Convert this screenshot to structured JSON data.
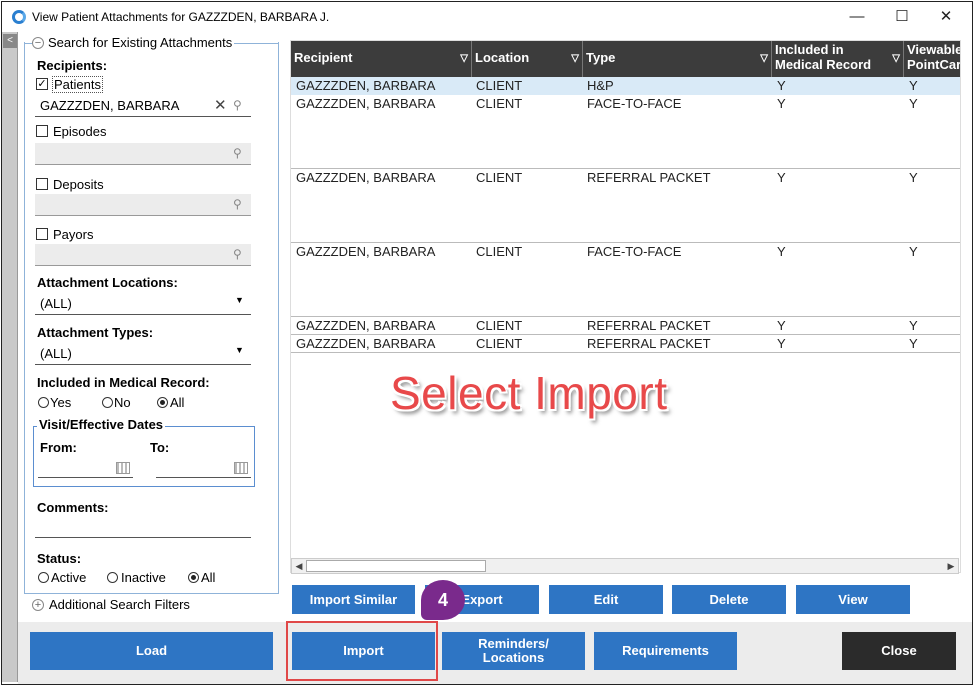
{
  "window": {
    "title": "View Patient Attachments for GAZZZDEN, BARBARA J.",
    "minimize": "—",
    "maximize": "☐",
    "close": "✕"
  },
  "search": {
    "legend": "Search for Existing Attachments",
    "recipients_label": "Recipients:",
    "patients_label": "Patients",
    "patients_checked": true,
    "patient_value": "GAZZZDEN, BARBARA",
    "episodes_label": "Episodes",
    "deposits_label": "Deposits",
    "payors_label": "Payors",
    "locations_label": "Attachment Locations:",
    "locations_value": "(ALL)",
    "types_label": "Attachment Types:",
    "types_value": "(ALL)",
    "medrec_label": "Included in Medical Record:",
    "medrec_options": [
      "Yes",
      "No",
      "All"
    ],
    "medrec_selected": "All",
    "dates_label": "Visit/Effective Dates",
    "from_label": "From:",
    "to_label": "To:",
    "comments_label": "Comments:",
    "status_label": "Status:",
    "status_options": [
      "Active",
      "Inactive",
      "All"
    ],
    "status_selected": "All",
    "additional_label": "Additional Search Filters"
  },
  "grid": {
    "columns": [
      "Recipient",
      "Location",
      "Type",
      "Included in Medical Record",
      "Viewable PointCar"
    ],
    "rows": [
      [
        "GAZZZDEN, BARBARA",
        "CLIENT",
        "H&P",
        "Y",
        "Y"
      ],
      [
        "GAZZZDEN, BARBARA",
        "CLIENT",
        "FACE-TO-FACE",
        "Y",
        "Y"
      ],
      [
        "GAZZZDEN, BARBARA",
        "CLIENT",
        "REFERRAL PACKET",
        "Y",
        "Y"
      ],
      [
        "GAZZZDEN, BARBARA",
        "CLIENT",
        "FACE-TO-FACE",
        "Y",
        "Y"
      ],
      [
        "GAZZZDEN, BARBARA",
        "CLIENT",
        "REFERRAL PACKET",
        "Y",
        "Y"
      ],
      [
        "GAZZZDEN, BARBARA",
        "CLIENT",
        "REFERRAL PACKET",
        "Y",
        "Y"
      ]
    ],
    "col1_line1": "Included in",
    "col1_line2": "Medical Record",
    "col2_line1": "Viewable",
    "col2_line2": "PointCar"
  },
  "actions": {
    "import_similar": "Import Similar",
    "export": "Export",
    "edit": "Edit",
    "delete": "Delete",
    "view": "View"
  },
  "bottom": {
    "load": "Load",
    "import": "Import",
    "reminders_line1": "Reminders/",
    "reminders_line2": "Locations",
    "requirements": "Requirements",
    "close": "Close"
  },
  "annotation": {
    "text": "Select Import",
    "step": "4"
  },
  "colors": {
    "button": "#2e75c4",
    "header": "#3c3c3c",
    "annotation": "#e8494a",
    "badge": "#7a2a8c"
  }
}
